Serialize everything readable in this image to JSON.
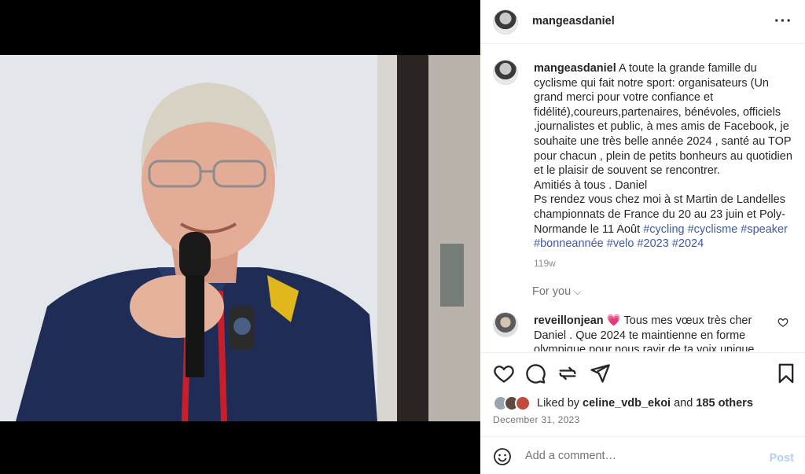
{
  "post": {
    "author": "mangeasdaniel",
    "caption": "A toute la grande famille du cyclisme qui fait notre sport: organisateurs (Un grand merci pour votre confiance et fidélité),coureurs,partenaires, bénévoles, officiels ,journalistes et public, à mes amis de Facebook, je souhaite une très belle année 2024 , santé au TOP pour chacun , plein de petits bonheurs au quotidien et le plaisir de souvent se rencontrer.",
    "caption_signoff": "Amitiés à tous . Daniel",
    "caption_ps": "Ps rendez vous chez moi à st Martin de Landelles championnats de France du 20 au 23 juin et Poly-Normande le 11 Août",
    "hashtags": [
      "#cycling",
      "#cyclisme",
      "#speaker",
      "#bonneannée",
      "#velo",
      "#2023",
      "#2024"
    ],
    "time_ago": "119w",
    "for_you_label": "For you",
    "likes_prefix": "Liked by",
    "likes_user": "celine_vdb_ekoi",
    "likes_and": "and",
    "likes_others": "185 others",
    "date": "December 31, 2023"
  },
  "comment": {
    "author": "reveillonjean",
    "emoji": "💗",
    "text": "Tous mes vœux très cher Daniel . Que 2024 te maintienne en forme olympique pour nous ravir de ta voix unique"
  },
  "composer": {
    "placeholder": "Add a comment…",
    "post_label": "Post"
  },
  "icons": {
    "more": "more-options-icon",
    "like": "heart-icon",
    "comment": "comment-icon",
    "share": "repost-icon",
    "send": "send-icon",
    "save": "bookmark-icon",
    "emoji": "emoji-icon"
  },
  "colors": {
    "hashtag": "#3e5aa8",
    "post_button": "#b3cdf5"
  }
}
